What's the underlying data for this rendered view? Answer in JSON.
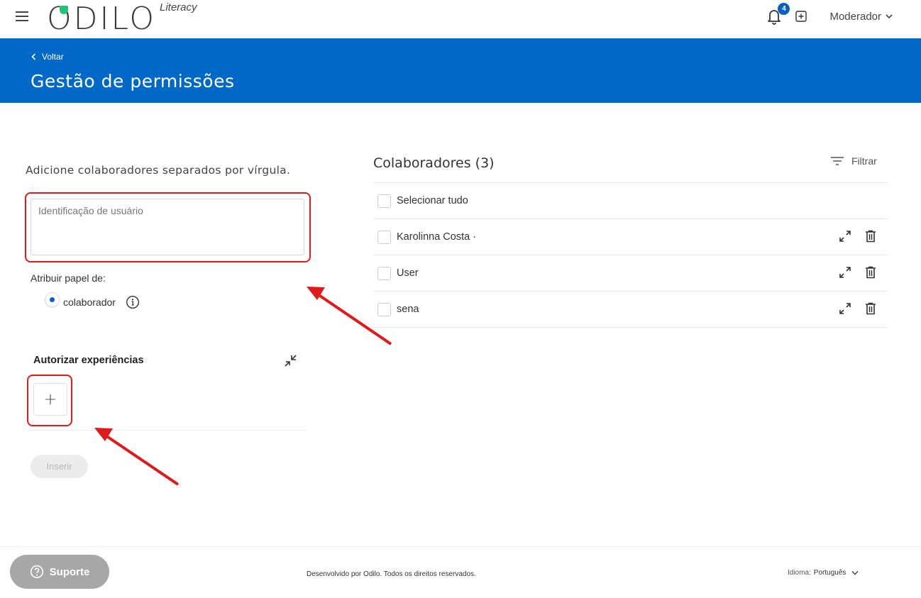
{
  "header": {
    "logo_text": "ODILO",
    "logo_sub": "Literacy",
    "notification_count": "4",
    "user_menu_label": "Moderador"
  },
  "banner": {
    "back_label": "Voltar",
    "title": "Gestão de permissões"
  },
  "form": {
    "instruction": "Adicione colaboradores separados por vírgula.",
    "user_input_placeholder": "Identificação de usuário",
    "user_input_value": "",
    "assign_role_label": "Atribuir papel de:",
    "role_option": "colaborador",
    "role_selected": true,
    "authorize_title": "Autorizar experiências",
    "add_label": "+",
    "insert_label": "Inserir"
  },
  "collaborators": {
    "title": "Colaboradores (3)",
    "filter_label": "Filtrar",
    "select_all_label": "Selecionar tudo",
    "items": [
      {
        "name": "Karolinna Costa ·"
      },
      {
        "name": "User"
      },
      {
        "name": "sena"
      }
    ]
  },
  "footer": {
    "support_label": "Suporte",
    "copyright": "Desenvolvido por Odilo. Todos os direitos reservados.",
    "language_label": "Idioma:",
    "language_value": "Português"
  },
  "colors": {
    "brand_blue": "#0068c7",
    "highlight_red": "#e01a1a",
    "logo_green": "#21c17a"
  },
  "icons": [
    "menu-icon",
    "bell-icon",
    "add-box-icon",
    "chevron-down-icon",
    "chevron-left-icon",
    "info-icon",
    "collapse-icon",
    "filter-icon",
    "expand-icon",
    "trash-icon",
    "help-circle-icon"
  ]
}
